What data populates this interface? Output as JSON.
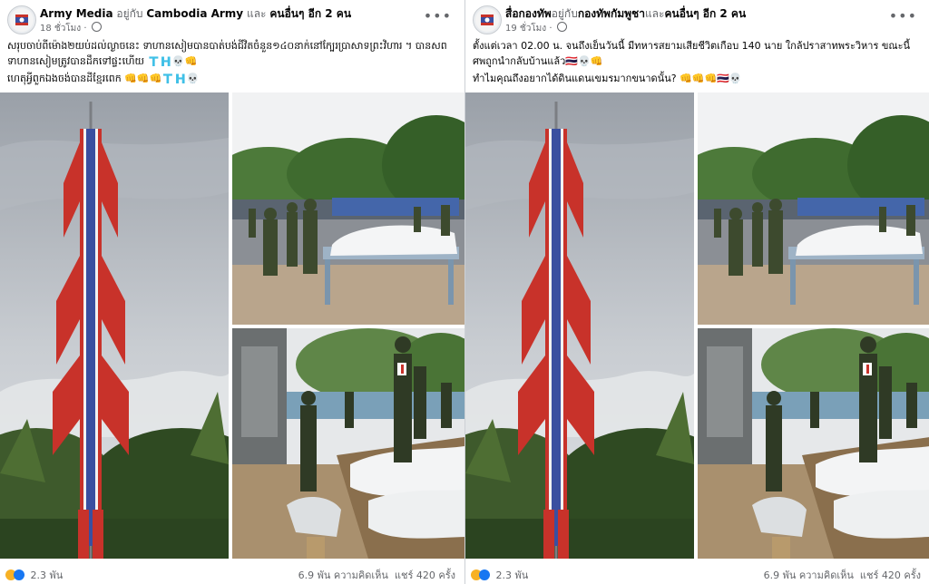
{
  "posts": [
    {
      "author": "Army Media",
      "with_text": "อยู่กับ",
      "tagged": "Cambodia Army",
      "and_text": "และ",
      "others": "คนอื่นๆ อีก 2 คน",
      "time": "18 ชั่วโมง",
      "line1": "សរុបចាប់ពីម៉ោង២យប់ដល់ល្ងាចនេះ ទាហានសៀមបានបាត់បង់ជីវិតចំនួន១៤០នាក់នៅក្បែរប្រាសាទព្រះវិហារ ។ បានសពទាហានសៀមត្រូវបានដឹកទៅផ្ទះហើយ 🇹🇭💀👊",
      "line2": "ហេតុអ្វីពួកឯងចង់បានដីខ្មែរពេក 👊👊👊🇹🇭💀",
      "reactions": "2.3 พัน",
      "comments": "6.9 พัน ความคิดเห็น",
      "shares": "แชร์ 420 ครั้ง"
    },
    {
      "author": "สื่อกองทัพ",
      "with_text": "อยู่กับ",
      "tagged": "กองทัพกัมพูชา",
      "and_text": "และ",
      "others": "คนอื่นๆ อีก 2 คน",
      "time": "19 ชั่วโมง",
      "line1": "ตั้งแต่เวลา 02.00 น. จนถึงเย็นวันนี้ มีทหารสยามเสียชีวิตเกือบ 140 นาย ใกล้ปราสาทพระวิหาร ขณะนี้ศพถูกนำกลับบ้านแล้ว🇹🇭💀👊",
      "line2": "ทำไมคุณถึงอยากได้ดินแดนเขมรมากขนาดนั้น? 👊👊👊🇹🇭💀",
      "reactions": "2.3 พัน",
      "comments": "6.9 พัน ความคิดเห็น",
      "shares": "แชร์ 420 ครั้ง"
    }
  ],
  "icons": {
    "more": "more-options-icon",
    "globe": "public-globe-icon",
    "haha": "haha-reaction-icon",
    "like": "like-reaction-icon"
  },
  "colors": {
    "flag_red": "#c8322a",
    "flag_blue": "#3a4fa0",
    "like": "#1877f2",
    "haha": "#f7b125"
  }
}
